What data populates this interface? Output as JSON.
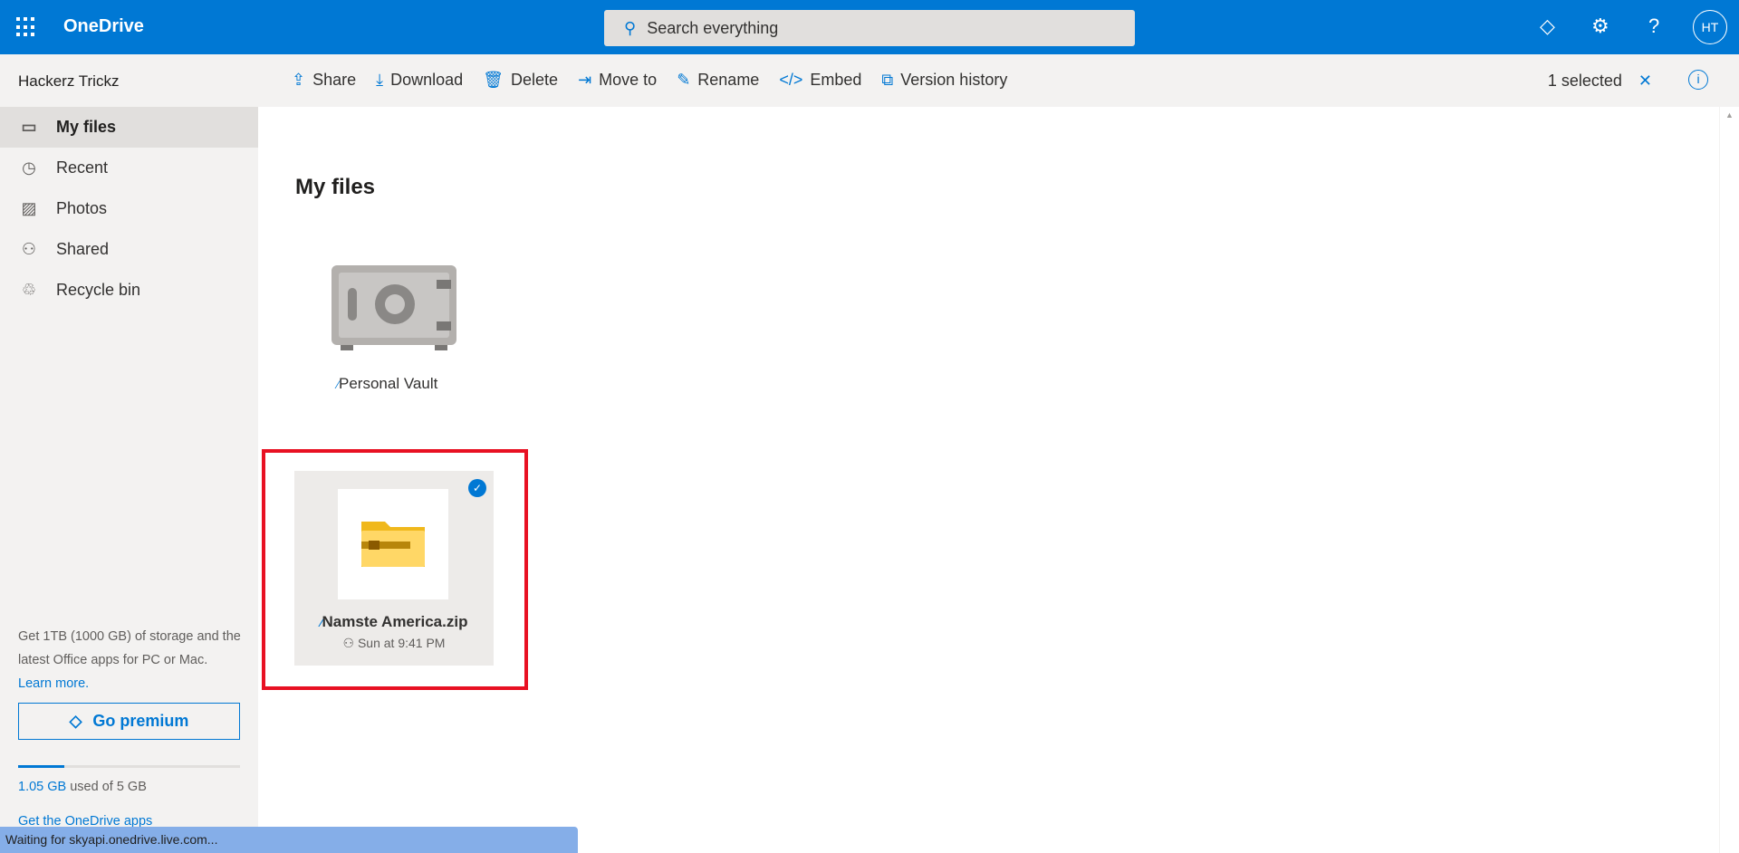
{
  "header": {
    "app_name": "OneDrive",
    "search_placeholder": "Search everything",
    "avatar_initials": "HT"
  },
  "toolbar": {
    "account": "Hackerz Trickz",
    "commands": [
      {
        "label": "Share",
        "icon": "share-icon"
      },
      {
        "label": "Download",
        "icon": "download-icon"
      },
      {
        "label": "Delete",
        "icon": "trash-icon"
      },
      {
        "label": "Move to",
        "icon": "move-icon"
      },
      {
        "label": "Rename",
        "icon": "pencil-icon"
      },
      {
        "label": "Embed",
        "icon": "code-icon"
      },
      {
        "label": "Version history",
        "icon": "history-icon"
      }
    ],
    "selection": "1 selected"
  },
  "sidebar": {
    "items": [
      {
        "label": "My files",
        "active": true
      },
      {
        "label": "Recent"
      },
      {
        "label": "Photos"
      },
      {
        "label": "Shared"
      },
      {
        "label": "Recycle bin"
      }
    ],
    "promo_text": "Get 1TB (1000 GB) of storage and the latest Office apps for PC or Mac.",
    "learn_more": "Learn more.",
    "go_premium": "Go premium",
    "storage_used": "1.05 GB",
    "storage_rest": " used of 5 GB",
    "storage_fraction": 0.21,
    "get_apps": "Get the OneDrive apps"
  },
  "main": {
    "title": "My files",
    "items": [
      {
        "name": "Personal Vault"
      },
      {
        "name": "Namste America.zip",
        "meta": "Sun at 9:41 PM",
        "selected": true
      }
    ]
  },
  "status_bar": "Waiting for skyapi.onedrive.live.com...",
  "colors": {
    "brand": "#0078d4",
    "highlight": "#e81123"
  }
}
